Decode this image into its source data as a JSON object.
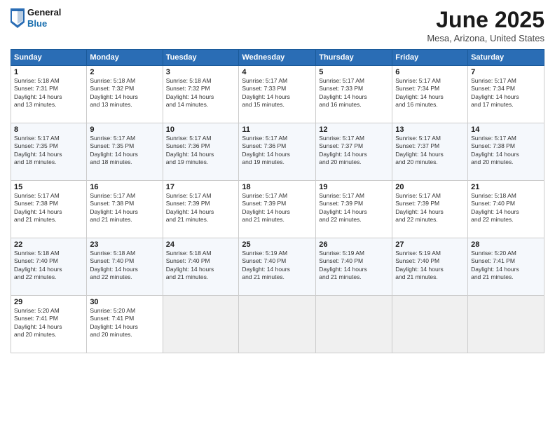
{
  "header": {
    "logo": {
      "general": "General",
      "blue": "Blue"
    },
    "title": "June 2025",
    "location": "Mesa, Arizona, United States"
  },
  "weekdays": [
    "Sunday",
    "Monday",
    "Tuesday",
    "Wednesday",
    "Thursday",
    "Friday",
    "Saturday"
  ],
  "weeks": [
    [
      {
        "day": 1,
        "sunrise": "5:18 AM",
        "sunset": "7:31 PM",
        "daylight": "14 hours and 13 minutes."
      },
      {
        "day": 2,
        "sunrise": "5:18 AM",
        "sunset": "7:32 PM",
        "daylight": "14 hours and 13 minutes."
      },
      {
        "day": 3,
        "sunrise": "5:18 AM",
        "sunset": "7:32 PM",
        "daylight": "14 hours and 14 minutes."
      },
      {
        "day": 4,
        "sunrise": "5:17 AM",
        "sunset": "7:33 PM",
        "daylight": "14 hours and 15 minutes."
      },
      {
        "day": 5,
        "sunrise": "5:17 AM",
        "sunset": "7:33 PM",
        "daylight": "14 hours and 16 minutes."
      },
      {
        "day": 6,
        "sunrise": "5:17 AM",
        "sunset": "7:34 PM",
        "daylight": "14 hours and 16 minutes."
      },
      {
        "day": 7,
        "sunrise": "5:17 AM",
        "sunset": "7:34 PM",
        "daylight": "14 hours and 17 minutes."
      }
    ],
    [
      {
        "day": 8,
        "sunrise": "5:17 AM",
        "sunset": "7:35 PM",
        "daylight": "14 hours and 18 minutes."
      },
      {
        "day": 9,
        "sunrise": "5:17 AM",
        "sunset": "7:35 PM",
        "daylight": "14 hours and 18 minutes."
      },
      {
        "day": 10,
        "sunrise": "5:17 AM",
        "sunset": "7:36 PM",
        "daylight": "14 hours and 19 minutes."
      },
      {
        "day": 11,
        "sunrise": "5:17 AM",
        "sunset": "7:36 PM",
        "daylight": "14 hours and 19 minutes."
      },
      {
        "day": 12,
        "sunrise": "5:17 AM",
        "sunset": "7:37 PM",
        "daylight": "14 hours and 20 minutes."
      },
      {
        "day": 13,
        "sunrise": "5:17 AM",
        "sunset": "7:37 PM",
        "daylight": "14 hours and 20 minutes."
      },
      {
        "day": 14,
        "sunrise": "5:17 AM",
        "sunset": "7:38 PM",
        "daylight": "14 hours and 20 minutes."
      }
    ],
    [
      {
        "day": 15,
        "sunrise": "5:17 AM",
        "sunset": "7:38 PM",
        "daylight": "14 hours and 21 minutes."
      },
      {
        "day": 16,
        "sunrise": "5:17 AM",
        "sunset": "7:38 PM",
        "daylight": "14 hours and 21 minutes."
      },
      {
        "day": 17,
        "sunrise": "5:17 AM",
        "sunset": "7:39 PM",
        "daylight": "14 hours and 21 minutes."
      },
      {
        "day": 18,
        "sunrise": "5:17 AM",
        "sunset": "7:39 PM",
        "daylight": "14 hours and 21 minutes."
      },
      {
        "day": 19,
        "sunrise": "5:17 AM",
        "sunset": "7:39 PM",
        "daylight": "14 hours and 22 minutes."
      },
      {
        "day": 20,
        "sunrise": "5:17 AM",
        "sunset": "7:39 PM",
        "daylight": "14 hours and 22 minutes."
      },
      {
        "day": 21,
        "sunrise": "5:18 AM",
        "sunset": "7:40 PM",
        "daylight": "14 hours and 22 minutes."
      }
    ],
    [
      {
        "day": 22,
        "sunrise": "5:18 AM",
        "sunset": "7:40 PM",
        "daylight": "14 hours and 22 minutes."
      },
      {
        "day": 23,
        "sunrise": "5:18 AM",
        "sunset": "7:40 PM",
        "daylight": "14 hours and 22 minutes."
      },
      {
        "day": 24,
        "sunrise": "5:18 AM",
        "sunset": "7:40 PM",
        "daylight": "14 hours and 21 minutes."
      },
      {
        "day": 25,
        "sunrise": "5:19 AM",
        "sunset": "7:40 PM",
        "daylight": "14 hours and 21 minutes."
      },
      {
        "day": 26,
        "sunrise": "5:19 AM",
        "sunset": "7:40 PM",
        "daylight": "14 hours and 21 minutes."
      },
      {
        "day": 27,
        "sunrise": "5:19 AM",
        "sunset": "7:40 PM",
        "daylight": "14 hours and 21 minutes."
      },
      {
        "day": 28,
        "sunrise": "5:20 AM",
        "sunset": "7:41 PM",
        "daylight": "14 hours and 21 minutes."
      }
    ],
    [
      {
        "day": 29,
        "sunrise": "5:20 AM",
        "sunset": "7:41 PM",
        "daylight": "14 hours and 20 minutes."
      },
      {
        "day": 30,
        "sunrise": "5:20 AM",
        "sunset": "7:41 PM",
        "daylight": "14 hours and 20 minutes."
      },
      null,
      null,
      null,
      null,
      null
    ]
  ]
}
